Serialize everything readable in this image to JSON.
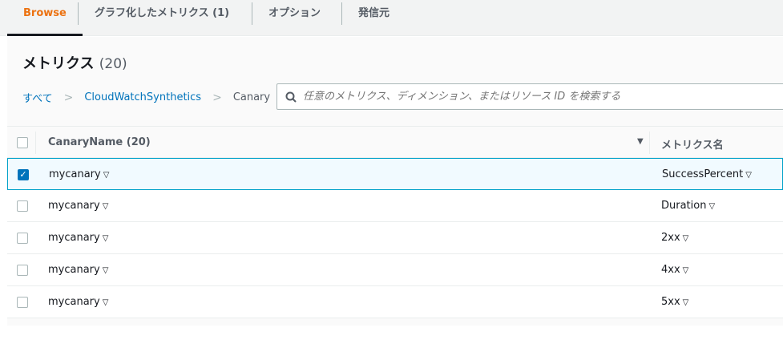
{
  "tabs": [
    {
      "label": "Browse",
      "active": true
    },
    {
      "label": "グラフ化したメトリクス (1)"
    },
    {
      "label": "オプション"
    },
    {
      "label": "発信元"
    }
  ],
  "title": "メトリクス",
  "count": "(20)",
  "breadcrumb": [
    "すべて",
    "CloudWatchSynthetics",
    "Canary"
  ],
  "search": {
    "placeholder": "任意のメトリクス、ディメンション、またはリソース ID を検索する"
  },
  "columns": [
    "CanaryName (20)",
    "メトリクス名"
  ],
  "rows": [
    {
      "canary": "mycanary",
      "metric": "SuccessPercent",
      "checked": true
    },
    {
      "canary": "mycanary",
      "metric": "Duration",
      "checked": false
    },
    {
      "canary": "mycanary",
      "metric": "2xx",
      "checked": false
    },
    {
      "canary": "mycanary",
      "metric": "4xx",
      "checked": false
    },
    {
      "canary": "mycanary",
      "metric": "5xx",
      "checked": false
    }
  ]
}
